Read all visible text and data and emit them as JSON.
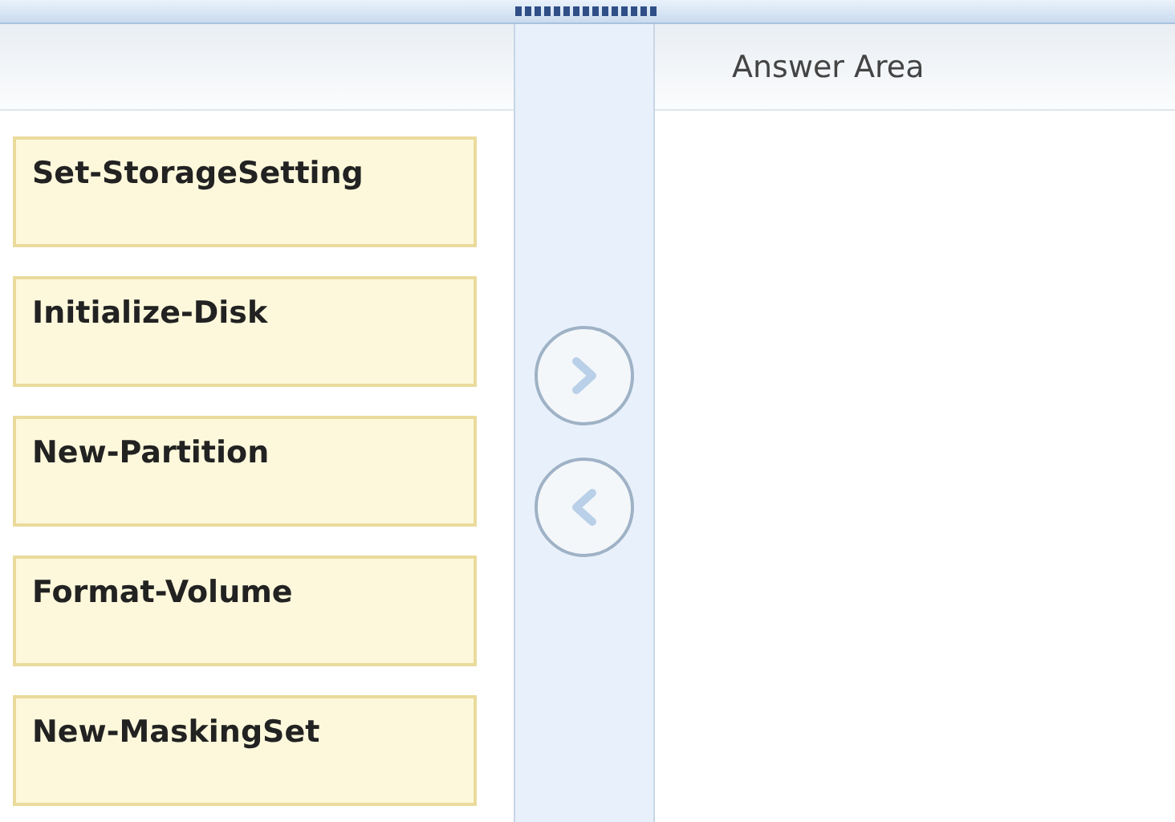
{
  "commands": [
    {
      "label": "Set-StorageSetting"
    },
    {
      "label": "Initialize-Disk"
    },
    {
      "label": "New-Partition"
    },
    {
      "label": "Format-Volume"
    },
    {
      "label": "New-MaskingSet"
    }
  ],
  "answer_area": {
    "title": "Answer Area"
  }
}
